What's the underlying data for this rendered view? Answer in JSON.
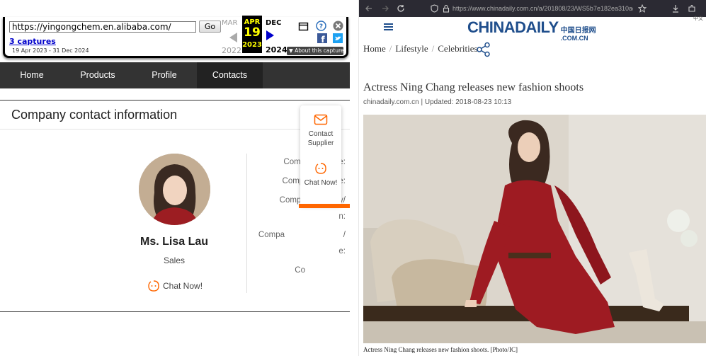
{
  "left_site": {
    "wayback": {
      "url": "https://yingongchem.en.alibaba.com/",
      "go_label": "Go",
      "captures": "3 captures",
      "range": "19 Apr 2023 - 31 Dec 2024",
      "prev_month": "MAR",
      "current_month": "APR",
      "current_day": "19",
      "current_year": "2023",
      "next_month": "DEC",
      "prev_year": "2022",
      "next_year": "2024",
      "about": "About this capture"
    },
    "nav": [
      "Home",
      "Products",
      "Profile",
      "Contacts"
    ],
    "card_title": "Company contact information",
    "person_name": "Ms. Lisa Lau",
    "person_role": "Sales",
    "chat_now": "Chat Now!",
    "labels": [
      "Company phone:",
      "Company mobile:",
      "Company country/",
      "n:",
      "Compa",
      "/",
      "e:",
      "Co"
    ],
    "float_contact": "Contact Supplier",
    "float_chat": "Chat Now!",
    "accent": "#ff6a00"
  },
  "right_site": {
    "url": "https://www.chinadaily.com.cn/a/201808/23/WS5b7e182ea310add",
    "logo": "CHINADAILY",
    "logo_cn": "中国日报网",
    "logo_com": ".COM.CN",
    "lang": "中文",
    "breadcrumb": [
      "Home",
      "Lifestyle",
      "Celebrities"
    ],
    "headline": "Actress Ning Chang releases new fashion shoots",
    "byline": "chinadaily.com.cn | Updated: 2018-08-23 10:13",
    "caption": "Actress Ning Chang releases new fashion shoots. [Photo/IC]",
    "brand_color": "#1f4e8c"
  }
}
